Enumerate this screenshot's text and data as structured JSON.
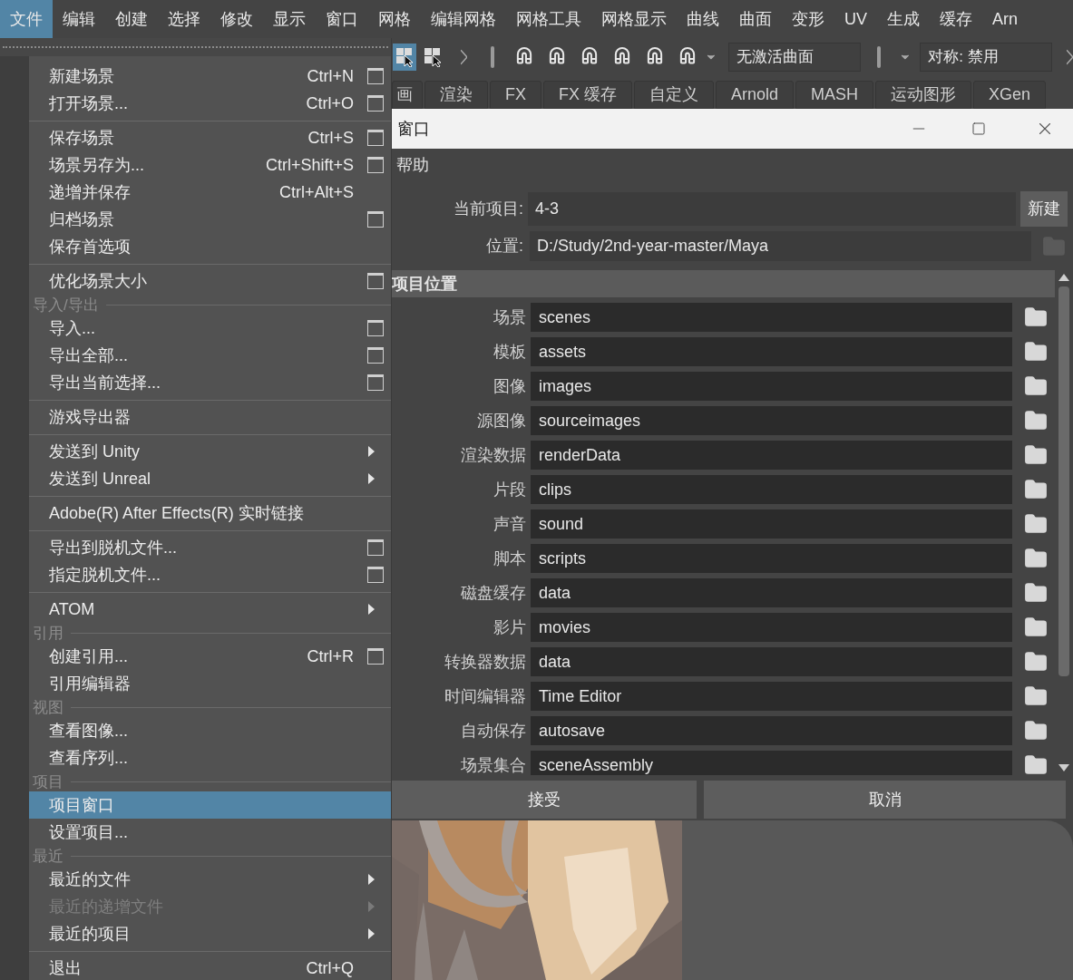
{
  "menubar": [
    {
      "label": "文件",
      "selected": true
    },
    {
      "label": "编辑",
      "selected": false
    },
    {
      "label": "创建",
      "selected": false
    },
    {
      "label": "选择",
      "selected": false
    },
    {
      "label": "修改",
      "selected": false
    },
    {
      "label": "显示",
      "selected": false
    },
    {
      "label": "窗口",
      "selected": false
    },
    {
      "label": "网格",
      "selected": false
    },
    {
      "label": "编辑网格",
      "selected": false
    },
    {
      "label": "网格工具",
      "selected": false
    },
    {
      "label": "网格显示",
      "selected": false
    },
    {
      "label": "曲线",
      "selected": false
    },
    {
      "label": "曲面",
      "selected": false
    },
    {
      "label": "变形",
      "selected": false
    },
    {
      "label": "UV",
      "selected": false
    },
    {
      "label": "生成",
      "selected": false
    },
    {
      "label": "缓存",
      "selected": false
    },
    {
      "label": "Arn",
      "selected": false
    }
  ],
  "toolbar": {
    "surface_field": "无激活曲面",
    "symmetry_field": "对称: 禁用"
  },
  "shelf_tabs": [
    "画",
    "渲染",
    "FX",
    "FX 缓存",
    "自定义",
    "Arnold",
    "MASH",
    "运动图形",
    "XGen"
  ],
  "file_menu": [
    {
      "kind": "item",
      "label": "新建场景",
      "shortcut": "Ctrl+N",
      "option_box": true,
      "submenu": false,
      "disabled": false,
      "selected": false
    },
    {
      "kind": "item",
      "label": "打开场景...",
      "shortcut": "Ctrl+O",
      "option_box": true,
      "submenu": false,
      "disabled": false,
      "selected": false
    },
    {
      "kind": "divider"
    },
    {
      "kind": "item",
      "label": "保存场景",
      "shortcut": "Ctrl+S",
      "option_box": true,
      "submenu": false,
      "disabled": false,
      "selected": false
    },
    {
      "kind": "item",
      "label": "场景另存为...",
      "shortcut": "Ctrl+Shift+S",
      "option_box": true,
      "submenu": false,
      "disabled": false,
      "selected": false
    },
    {
      "kind": "item",
      "label": "递增并保存",
      "shortcut": "Ctrl+Alt+S",
      "option_box": false,
      "submenu": false,
      "disabled": false,
      "selected": false
    },
    {
      "kind": "item",
      "label": "归档场景",
      "option_box": true,
      "submenu": false,
      "disabled": false,
      "selected": false
    },
    {
      "kind": "item",
      "label": "保存首选项",
      "option_box": false,
      "submenu": false,
      "disabled": false,
      "selected": false
    },
    {
      "kind": "divider"
    },
    {
      "kind": "item",
      "label": "优化场景大小",
      "option_box": true,
      "submenu": false,
      "disabled": false,
      "selected": false
    },
    {
      "kind": "section",
      "label": "导入/导出"
    },
    {
      "kind": "item",
      "label": "导入...",
      "option_box": true,
      "submenu": false,
      "disabled": false,
      "selected": false
    },
    {
      "kind": "item",
      "label": "导出全部...",
      "option_box": true,
      "submenu": false,
      "disabled": false,
      "selected": false
    },
    {
      "kind": "item",
      "label": "导出当前选择...",
      "option_box": true,
      "submenu": false,
      "disabled": false,
      "selected": false
    },
    {
      "kind": "divider"
    },
    {
      "kind": "item",
      "label": "游戏导出器",
      "option_box": false,
      "submenu": false,
      "disabled": false,
      "selected": false
    },
    {
      "kind": "divider"
    },
    {
      "kind": "item",
      "label": "发送到 Unity",
      "option_box": false,
      "submenu": true,
      "disabled": false,
      "selected": false
    },
    {
      "kind": "item",
      "label": "发送到 Unreal",
      "option_box": false,
      "submenu": true,
      "disabled": false,
      "selected": false
    },
    {
      "kind": "divider"
    },
    {
      "kind": "item",
      "label": "Adobe(R) After Effects(R) 实时链接",
      "option_box": false,
      "submenu": false,
      "disabled": false,
      "selected": false
    },
    {
      "kind": "divider"
    },
    {
      "kind": "item",
      "label": "导出到脱机文件...",
      "option_box": true,
      "submenu": false,
      "disabled": false,
      "selected": false
    },
    {
      "kind": "item",
      "label": "指定脱机文件...",
      "option_box": true,
      "submenu": false,
      "disabled": false,
      "selected": false
    },
    {
      "kind": "divider"
    },
    {
      "kind": "item",
      "label": "ATOM",
      "option_box": false,
      "submenu": true,
      "disabled": false,
      "selected": false
    },
    {
      "kind": "section",
      "label": "引用"
    },
    {
      "kind": "item",
      "label": "创建引用...",
      "shortcut": "Ctrl+R",
      "option_box": true,
      "submenu": false,
      "disabled": false,
      "selected": false
    },
    {
      "kind": "item",
      "label": "引用编辑器",
      "option_box": false,
      "submenu": false,
      "disabled": false,
      "selected": false
    },
    {
      "kind": "section",
      "label": "视图"
    },
    {
      "kind": "item",
      "label": "查看图像...",
      "option_box": false,
      "submenu": false,
      "disabled": false,
      "selected": false
    },
    {
      "kind": "item",
      "label": "查看序列...",
      "option_box": false,
      "submenu": false,
      "disabled": false,
      "selected": false
    },
    {
      "kind": "section",
      "label": "项目"
    },
    {
      "kind": "item",
      "label": "项目窗口",
      "option_box": false,
      "submenu": false,
      "disabled": false,
      "selected": true
    },
    {
      "kind": "item",
      "label": "设置项目...",
      "option_box": false,
      "submenu": false,
      "disabled": false,
      "selected": false
    },
    {
      "kind": "section",
      "label": "最近"
    },
    {
      "kind": "item",
      "label": "最近的文件",
      "option_box": false,
      "submenu": true,
      "disabled": false,
      "selected": false
    },
    {
      "kind": "item",
      "label": "最近的递增文件",
      "option_box": false,
      "submenu": true,
      "disabled": true,
      "selected": false
    },
    {
      "kind": "item",
      "label": "最近的项目",
      "option_box": false,
      "submenu": true,
      "disabled": false,
      "selected": false
    },
    {
      "kind": "divider"
    },
    {
      "kind": "item",
      "label": "退出",
      "shortcut": "Ctrl+Q",
      "option_box": false,
      "submenu": false,
      "disabled": false,
      "selected": false
    }
  ],
  "dialog": {
    "title": "窗口",
    "menu": [
      "帮助"
    ],
    "current_project": {
      "label": "当前项目:",
      "value": "4-3"
    },
    "new_button": "新建",
    "location": {
      "label": "位置:",
      "value": "D:/Study/2nd-year-master/Maya"
    },
    "section_title": "项目位置",
    "locations": [
      {
        "label": "场景",
        "value": "scenes"
      },
      {
        "label": "模板",
        "value": "assets"
      },
      {
        "label": "图像",
        "value": "images"
      },
      {
        "label": "源图像",
        "value": "sourceimages"
      },
      {
        "label": "渲染数据",
        "value": "renderData"
      },
      {
        "label": "片段",
        "value": "clips"
      },
      {
        "label": "声音",
        "value": "sound"
      },
      {
        "label": "脚本",
        "value": "scripts"
      },
      {
        "label": "磁盘缓存",
        "value": "data"
      },
      {
        "label": "影片",
        "value": "movies"
      },
      {
        "label": "转换器数据",
        "value": "data"
      },
      {
        "label": "时间编辑器",
        "value": "Time Editor"
      },
      {
        "label": "自动保存",
        "value": "autosave"
      },
      {
        "label": "场景集合",
        "value": "sceneAssembly"
      }
    ],
    "buttons": [
      "接受",
      "取消"
    ]
  }
}
